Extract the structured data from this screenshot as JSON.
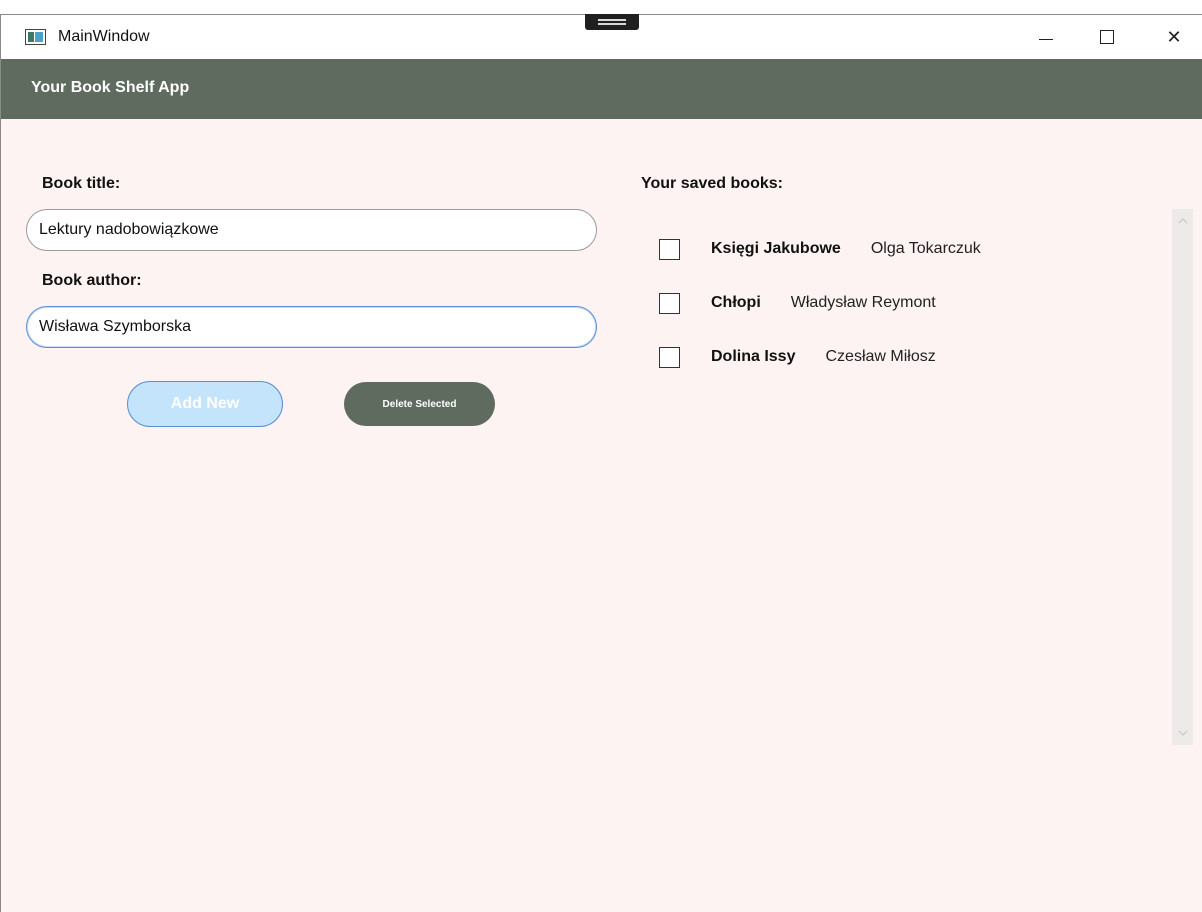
{
  "window": {
    "title": "MainWindow",
    "controls": {
      "minimize_icon": "minimize-icon",
      "maximize_icon": "maximize-icon",
      "close_symbol": "✕"
    }
  },
  "header": {
    "title": "Your Book Shelf App"
  },
  "form": {
    "title_label": "Book title:",
    "title_value": "Lektury nadobowiązkowe",
    "author_label": "Book author:",
    "author_value": "Wisława Szymborska",
    "add_button": "Add New",
    "delete_button": "Delete Selected"
  },
  "books": {
    "heading": "Your saved books:",
    "items": [
      {
        "title": "Księgi Jakubowe",
        "author": "Olga Tokarczuk",
        "checked": false
      },
      {
        "title": "Chłopi",
        "author": "Władysław Reymont",
        "checked": false
      },
      {
        "title": "Dolina Issy",
        "author": "Czesław Miłosz",
        "checked": false
      }
    ]
  },
  "colors": {
    "header_bg": "#606b60",
    "page_bg": "#fdf3f3",
    "add_button_bg": "#c4e4fb",
    "delete_button_bg": "#606b60"
  }
}
